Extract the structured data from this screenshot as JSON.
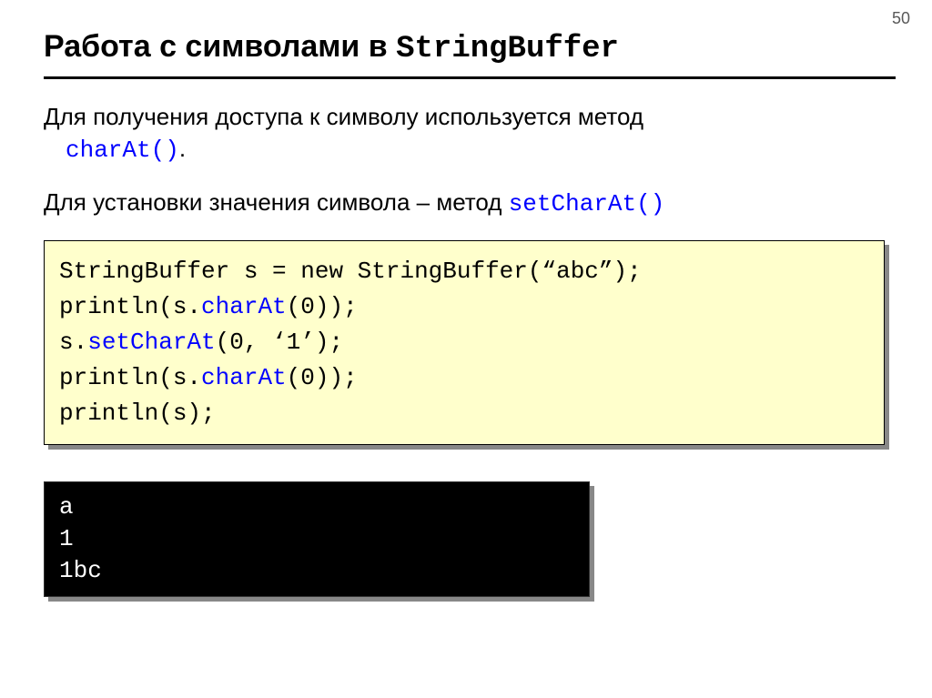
{
  "page_number": "50",
  "title": {
    "prefix": "Работа с символами в ",
    "class_name": "StringBuffer"
  },
  "para1": {
    "text": "Для получения доступа к символу используется метод",
    "method": "charAt()",
    "tail": "."
  },
  "para2": {
    "text": "Для установки значения символа – метод ",
    "method": "setCharAt()"
  },
  "code": {
    "l1a": "StringBuffer s = new StringBuffer(“abc”);",
    "l2a": "println(s.",
    "l2b": "charAt",
    "l2c": "(0));",
    "l3a": "s.",
    "l3b": "setCharAt",
    "l3c": "(0, ‘1’);",
    "l4a": "println(s.",
    "l4b": "charAt",
    "l4c": "(0));",
    "l5a": "println(s);"
  },
  "output": {
    "l1": "a",
    "l2": "1",
    "l3": "1bc"
  }
}
